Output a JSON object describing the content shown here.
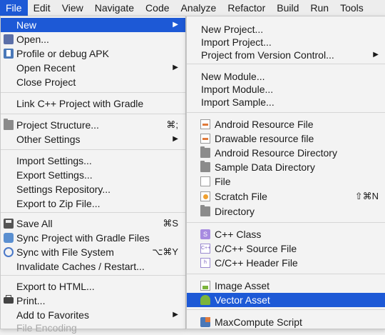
{
  "menubar": [
    "File",
    "Edit",
    "View",
    "Navigate",
    "Code",
    "Analyze",
    "Refactor",
    "Build",
    "Run",
    "Tools"
  ],
  "file_menu": {
    "new": "New",
    "open": "Open...",
    "profile": "Profile or debug APK",
    "open_recent": "Open Recent",
    "close_project": "Close Project",
    "link_cpp": "Link C++ Project with Gradle",
    "project_structure": "Project Structure...",
    "project_structure_sc": "⌘;",
    "other_settings": "Other Settings",
    "import_settings": "Import Settings...",
    "export_settings": "Export Settings...",
    "settings_repo": "Settings Repository...",
    "export_zip": "Export to Zip File...",
    "save_all": "Save All",
    "save_all_sc": "⌘S",
    "sync_gradle": "Sync Project with Gradle Files",
    "sync_fs": "Sync with File System",
    "sync_fs_sc": "⌥⌘Y",
    "invalidate": "Invalidate Caches / Restart...",
    "export_html": "Export to HTML...",
    "print": "Print...",
    "add_fav": "Add to Favorites",
    "file_encoding": "File Encoding"
  },
  "new_menu": {
    "new_project": "New Project...",
    "import_project": "Import Project...",
    "project_from_vcs": "Project from Version Control...",
    "new_module": "New Module...",
    "import_module": "Import Module...",
    "import_sample": "Import Sample...",
    "android_res_file": "Android Resource File",
    "drawable_res_file": "Drawable resource file",
    "android_res_dir": "Android Resource Directory",
    "sample_data_dir": "Sample Data Directory",
    "file": "File",
    "scratch_file": "Scratch File",
    "scratch_file_sc": "⇧⌘N",
    "directory": "Directory",
    "cpp_class": "C++ Class",
    "cpp_source": "C/C++ Source File",
    "cpp_header": "C/C++ Header File",
    "image_asset": "Image Asset",
    "vector_asset": "Vector Asset",
    "maxcompute": "MaxCompute Script"
  }
}
